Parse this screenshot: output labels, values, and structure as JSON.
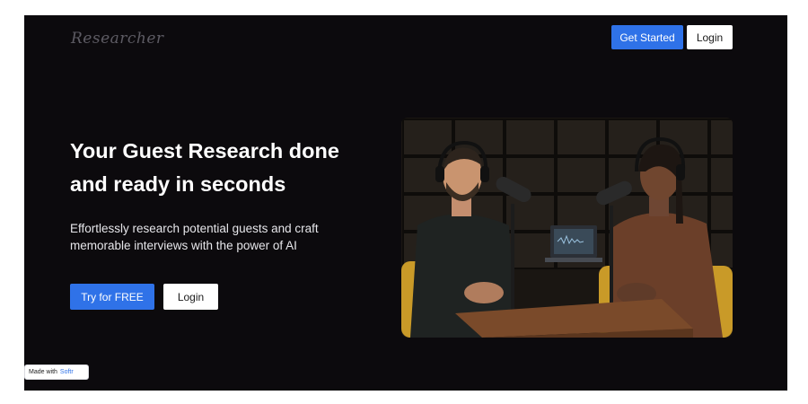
{
  "header": {
    "logo_text": "Researcher",
    "get_started_label": "Get Started",
    "login_label": "Login"
  },
  "hero": {
    "title": "Your Guest Research done and ready in seconds",
    "subtitle": "Effortlessly research potential guests and craft memorable interviews with the power of AI",
    "cta_primary_label": "Try for FREE",
    "cta_secondary_label": "Login"
  },
  "badge": {
    "prefix": "Made with",
    "brand": "Softr"
  },
  "colors": {
    "page_bg": "#0c0a0d",
    "accent": "#2f72e8",
    "text_primary": "#ffffff"
  }
}
